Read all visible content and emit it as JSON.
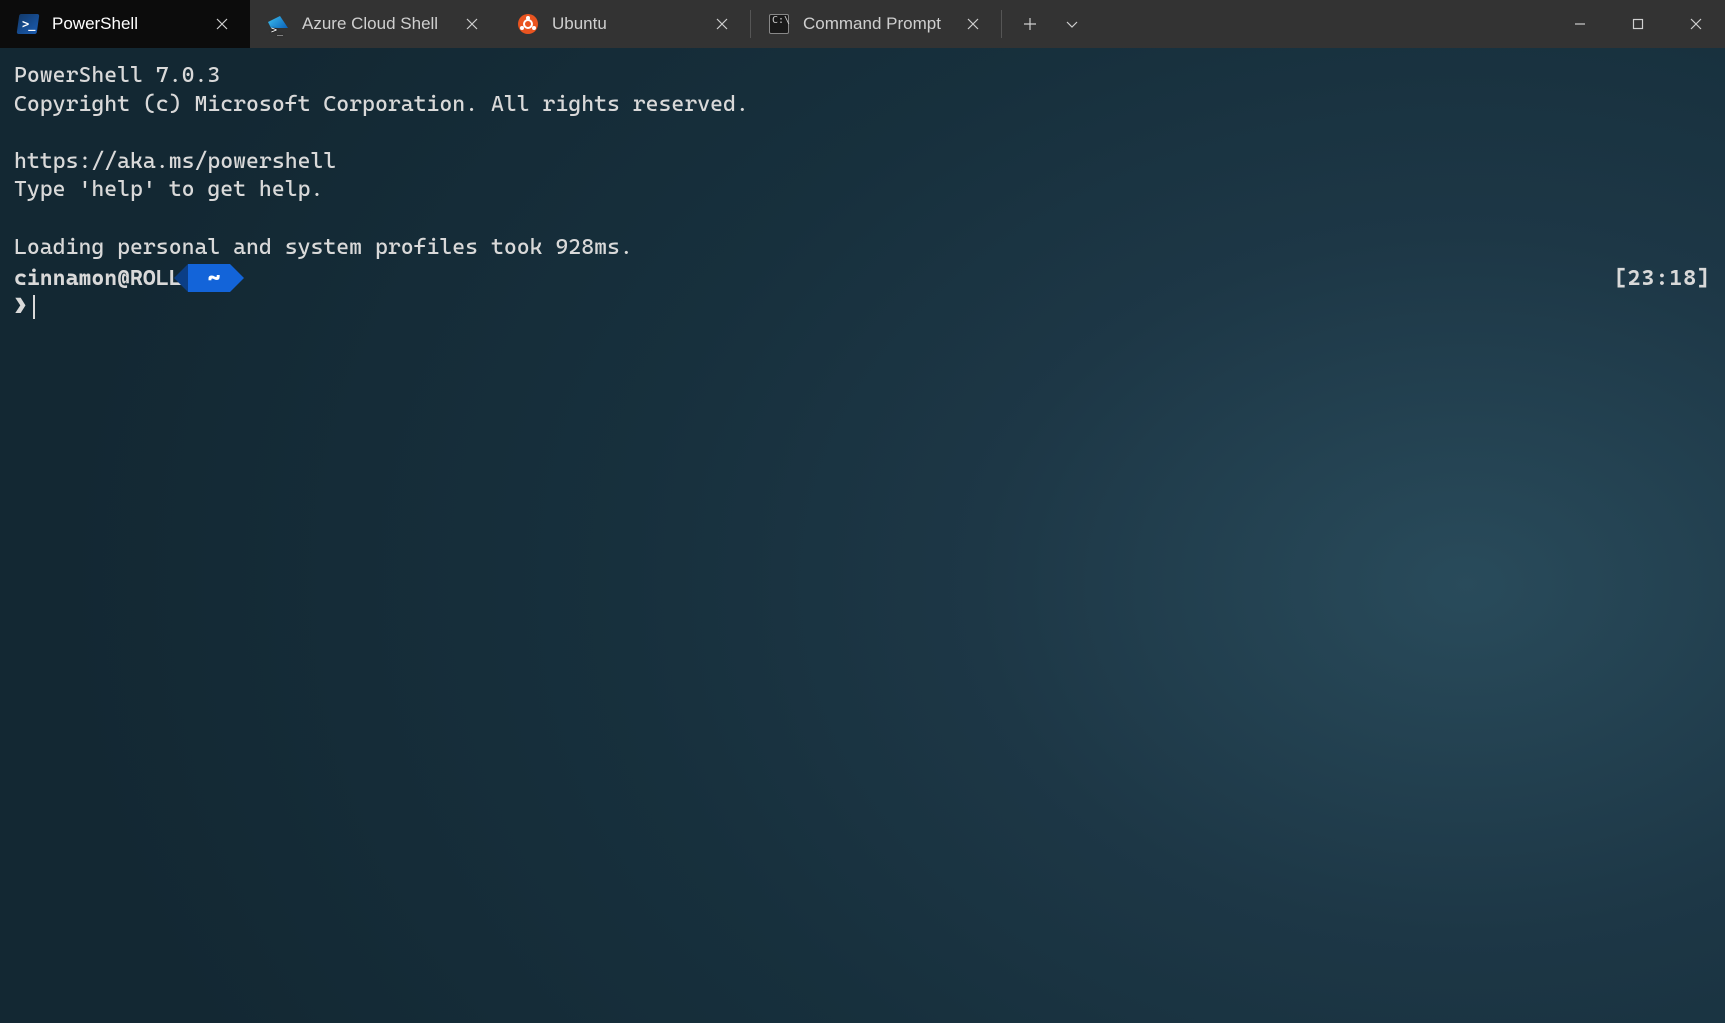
{
  "tabs": [
    {
      "label": "PowerShell",
      "icon": "powershell",
      "active": true
    },
    {
      "label": "Azure Cloud Shell",
      "icon": "azure",
      "active": false
    },
    {
      "label": "Ubuntu",
      "icon": "ubuntu",
      "active": false
    },
    {
      "label": "Command Prompt",
      "icon": "cmd",
      "active": false
    }
  ],
  "terminal": {
    "lines": [
      "PowerShell 7.0.3",
      "Copyright (c) Microsoft Corporation. All rights reserved.",
      "",
      "https://aka.ms/powershell",
      "Type 'help' to get help.",
      "",
      "Loading personal and system profiles took 928ms."
    ],
    "prompt": {
      "user_host": "cinnamon@ROLL",
      "segment": "~",
      "time": "[23:18]",
      "caret": "❯"
    }
  }
}
